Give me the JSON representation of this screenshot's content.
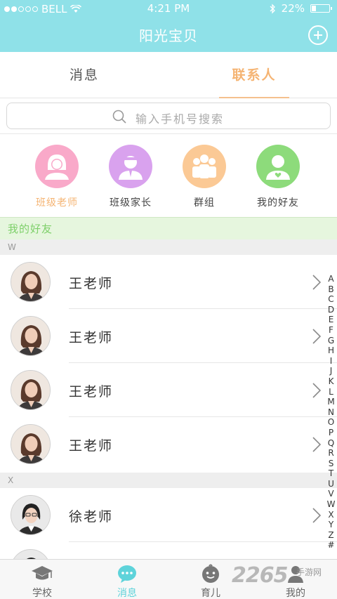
{
  "status_bar": {
    "carrier": "BELL",
    "time": "4:21 PM",
    "battery": "22%",
    "signal_dots_filled": 2,
    "signal_dots_total": 5,
    "battery_level": 0.22
  },
  "header": {
    "title": "阳光宝贝",
    "add_icon": "plus-circle-icon"
  },
  "tabs": [
    {
      "label": "消息",
      "active": false
    },
    {
      "label": "联系人",
      "active": true
    }
  ],
  "search": {
    "placeholder": "输入手机号搜索"
  },
  "categories": [
    {
      "label": "班级老师",
      "icon": "teacher-icon",
      "color": "#f9a9c9",
      "active": true
    },
    {
      "label": "班级家长",
      "icon": "parent-icon",
      "color": "#d9a2ee"
    },
    {
      "label": "群组",
      "icon": "group-icon",
      "color": "#fbc995"
    },
    {
      "label": "我的好友",
      "icon": "friend-icon",
      "color": "#8ddb7b"
    }
  ],
  "friends_header": "我的好友",
  "sections": {
    "w": {
      "letter": "W",
      "contacts": [
        {
          "name": "王老师"
        },
        {
          "name": "王老师"
        },
        {
          "name": "王老师"
        },
        {
          "name": "王老师"
        }
      ]
    },
    "x": {
      "letter": "X",
      "contacts": [
        {
          "name": "徐老师"
        }
      ]
    }
  },
  "index_letters": [
    "A",
    "B",
    "C",
    "D",
    "E",
    "F",
    "G",
    "H",
    "I",
    "J",
    "K",
    "L",
    "M",
    "N",
    "O",
    "P",
    "Q",
    "R",
    "S",
    "T",
    "U",
    "V",
    "W",
    "X",
    "Y",
    "Z",
    "#"
  ],
  "bottom_nav": [
    {
      "label": "学校",
      "icon": "graduation-cap-icon"
    },
    {
      "label": "消息",
      "icon": "chat-bubble-icon",
      "active": true
    },
    {
      "label": "育儿",
      "icon": "baby-face-icon"
    },
    {
      "label": "我的",
      "icon": "person-icon"
    }
  ],
  "watermark": {
    "text": "2265",
    "sub": "手游网"
  },
  "colors": {
    "header": "#8fe1e8",
    "accent_orange": "#f5b473",
    "accent_teal": "#5ed3da",
    "friends_green": "#7ed06a"
  }
}
